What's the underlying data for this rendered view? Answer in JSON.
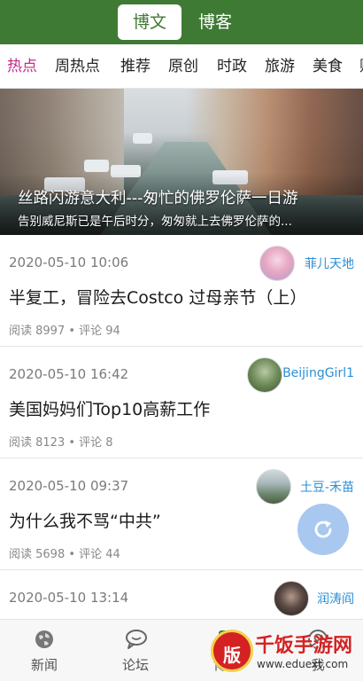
{
  "header": {
    "tabs": [
      {
        "label": "博文",
        "active": true
      },
      {
        "label": "博客",
        "active": false
      }
    ],
    "color": "#3f7a34"
  },
  "categories": [
    {
      "label": "热点",
      "active": true
    },
    {
      "label": "周热点"
    },
    {
      "label": "推荐"
    },
    {
      "label": "原创"
    },
    {
      "label": "时政"
    },
    {
      "label": "旅游"
    },
    {
      "label": "美食"
    },
    {
      "label": "财"
    }
  ],
  "hero": {
    "title": "丝路闪游意大利---匆忙的佛罗伦萨一日游",
    "subtitle": "告别威尼斯已是午后时分，匆匆就上去佛罗伦萨的..."
  },
  "articles": [
    {
      "date": "2020-05-10 10:06",
      "title": "半复工，冒险去Costco 过母亲节（上）",
      "stats": "阅读 8997 • 评论 94",
      "author": "菲儿天地",
      "avatar": "flower-portrait"
    },
    {
      "date": "2020-05-10 16:42",
      "title": "美国妈妈们Top10高薪工作",
      "stats": "阅读 8123 • 评论 8",
      "author": "BeijingGirl1",
      "avatar": "garden-photo"
    },
    {
      "date": "2020-05-10 09:37",
      "title": "为什么我不骂“中共”",
      "stats": "阅读 5698 • 评论 44",
      "author": "土豆-禾苗",
      "avatar": "lakeside-photo"
    },
    {
      "date": "2020-05-10 13:14",
      "title": "",
      "stats": "",
      "author": "润涛阎",
      "avatar": "dark-portrait"
    }
  ],
  "fab": {
    "icon": "refresh-icon",
    "color": "#a9c8ef"
  },
  "bottom_nav": [
    {
      "label": "新闻",
      "icon": "globe-icon"
    },
    {
      "label": "论坛",
      "icon": "chat-bubble-icon"
    },
    {
      "label": "博客",
      "icon": "blog-icon"
    },
    {
      "label": "我",
      "icon": "user-icon"
    }
  ],
  "watermark": {
    "badge": "版",
    "title": "千饭手游网",
    "url": "www.eduext.com"
  }
}
